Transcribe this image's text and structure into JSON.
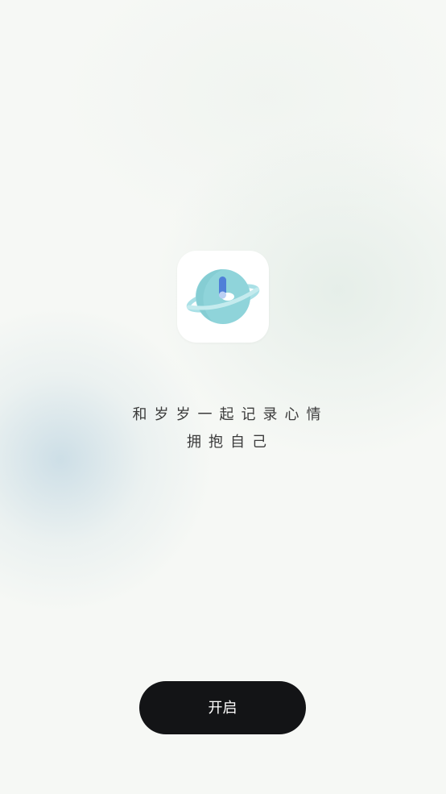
{
  "app": {
    "icon": "planet-clock-icon"
  },
  "slogan": {
    "line1": "和岁岁一起记录心情",
    "line2": "拥抱自己"
  },
  "actions": {
    "start_label": "开启"
  },
  "colors": {
    "background": "#f6f8f5",
    "button": "#131416",
    "button_text": "#ffffff",
    "planet": "#8fd4da",
    "ring": "#a9e0e6",
    "clock_hand": "#4f7fd8"
  }
}
